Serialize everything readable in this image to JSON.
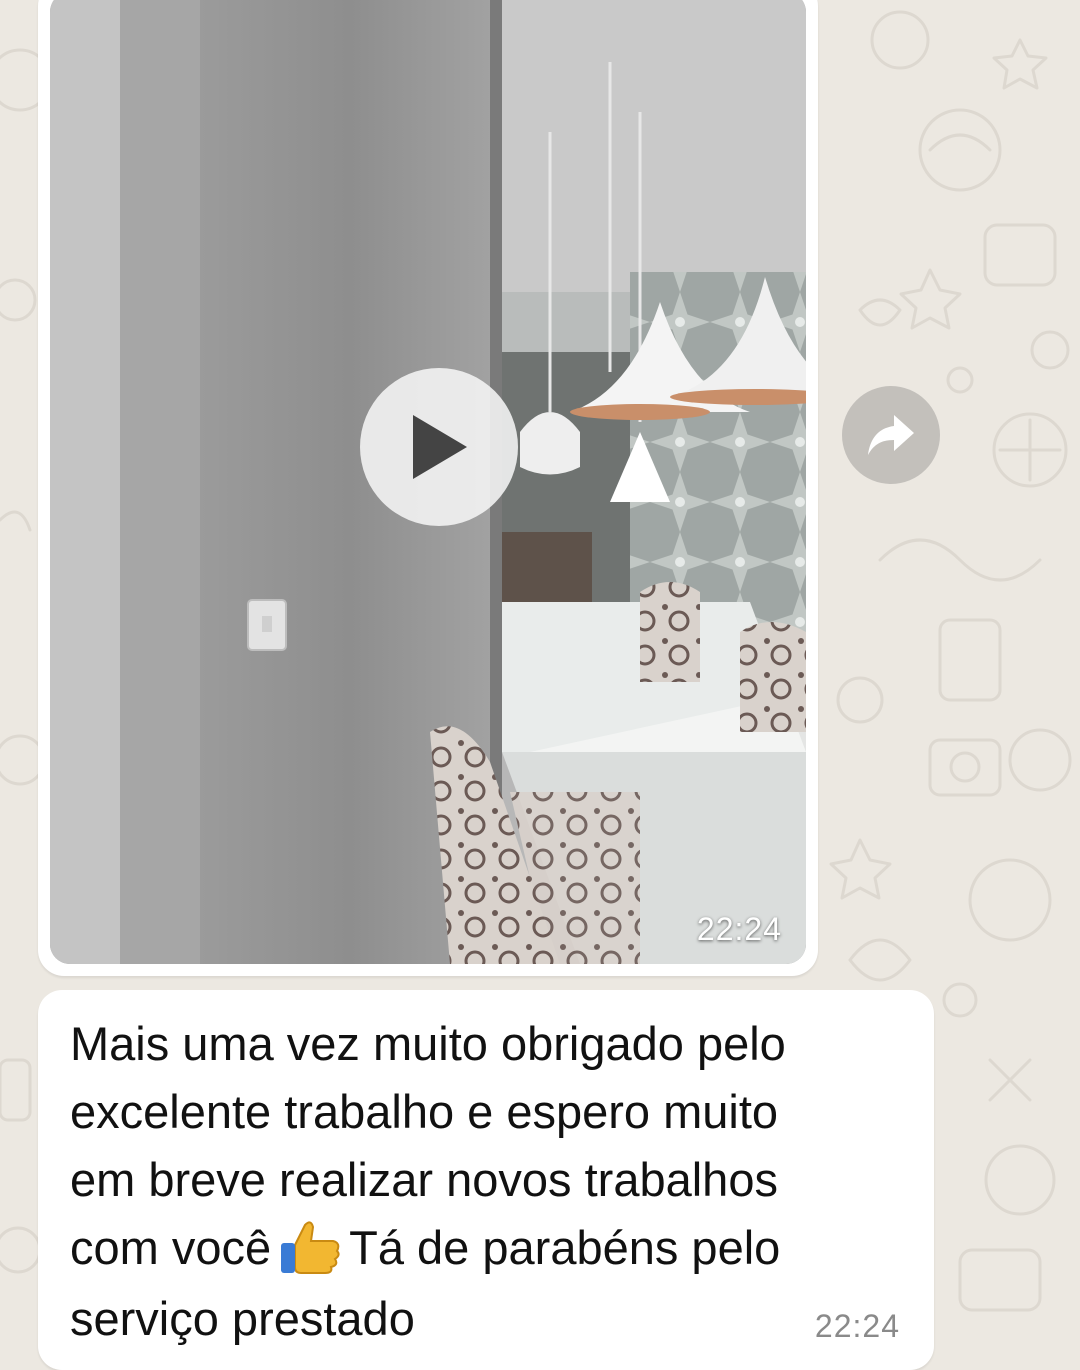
{
  "chat": {
    "video_message": {
      "time": "22:24",
      "play_icon": "play-icon",
      "forward_icon": "forward-arrow-icon"
    },
    "text_message": {
      "line1": "Mais uma vez muito obrigado pelo",
      "line2": "excelente trabalho e espero muito",
      "line3": "em breve realizar novos trabalhos",
      "line4_before_emoji": "com você",
      "emoji": "thumbs-up-icon",
      "line4_after_emoji": "Tá de parabéns pelo",
      "line5": "serviço prestado",
      "time": "22:24"
    }
  },
  "colors": {
    "wallpaper": "#ece8e1",
    "bubble": "#ffffff",
    "timestamp": "#8a8a8a"
  }
}
